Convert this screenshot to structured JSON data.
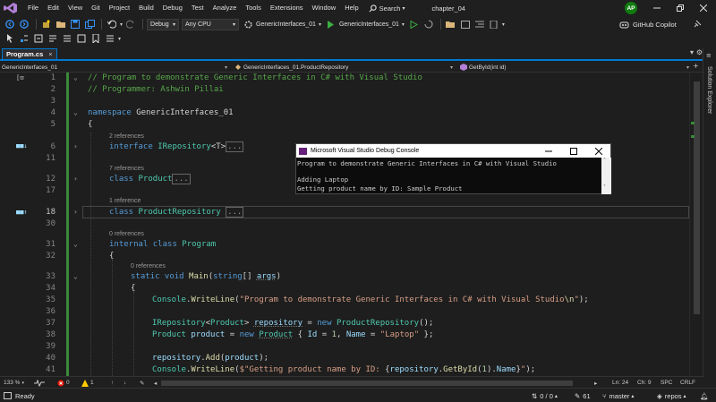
{
  "menubar": {
    "items": [
      {
        "label": "File"
      },
      {
        "label": "Edit"
      },
      {
        "label": "View"
      },
      {
        "label": "Git"
      },
      {
        "label": "Project"
      },
      {
        "label": "Build"
      },
      {
        "label": "Debug"
      },
      {
        "label": "Test"
      },
      {
        "label": "Analyze"
      },
      {
        "label": "Tools"
      },
      {
        "label": "Extensions"
      },
      {
        "label": "Window"
      },
      {
        "label": "Help"
      }
    ],
    "search_label": "Search",
    "solution_name": "chapter_04",
    "avatar_initials": "AP"
  },
  "toolbar": {
    "configuration": "Debug",
    "platform": "Any CPU",
    "startup_project": "GenericInterfaces_01",
    "run_target": "GenericInterfaces_01",
    "copilot_label": "GitHub Copilot"
  },
  "tab": {
    "title": "Program.cs",
    "close_glyph": "×"
  },
  "navbar": {
    "project": "GenericInterfaces_01",
    "type": "GenericInterfaces_01.ProductRepository",
    "member": "GetById(int id)"
  },
  "side_panel": {
    "label": "Solution Explorer"
  },
  "editor": {
    "line_numbers": [
      "1",
      "2",
      "3",
      "4",
      "5",
      "6",
      "11",
      "12",
      "17",
      "18",
      "30",
      "31",
      "32",
      "33",
      "34",
      "35",
      "36",
      "37",
      "38",
      "39",
      "40",
      "41"
    ],
    "codelens": {
      "refs_2": "2 references",
      "refs_7": "7 references",
      "refs_1": "1 reference",
      "refs_0a": "0 references",
      "refs_0b": "0 references"
    },
    "code": {
      "l1_comment": "// Program to demonstrate Generic Interfaces in C# with Visual Studio",
      "l2_comment": "// Programmer: Ashwin Pillai",
      "l4_kw": "namespace",
      "l4_name": "GenericInterfaces_01",
      "brace_open": "{",
      "l6_kw": "interface",
      "l6_name": "IRepository",
      "l6_generic": "<T>",
      "collapsed": "...",
      "l12_kw": "class",
      "l12_name": "Product",
      "l18_kw": "class",
      "l18_name": "ProductRepository",
      "l31_kw": "internal class",
      "l31_name": "Program",
      "l33_kw": "static void",
      "l33_name": "Main",
      "l33_paren_open": "(",
      "l33_type": "string",
      "l33_rest": "[] ",
      "l33_arg": "args",
      "l33_paren_close": ")",
      "l35_obj": "Console",
      "l35_dot": ".",
      "l35_method": "WriteLine",
      "l35_open": "(",
      "l35_string": "\"Program to demonstrate Generic Interfaces in C# with Visual Studio",
      "l35_escape": "\\n",
      "l35_string_end": "\"",
      "l35_close": ");",
      "l37_type": "IRepository",
      "l37_lt": "<",
      "l37_type2": "Product",
      "l37_gt": "> ",
      "l37_var": "repository",
      "l37_eq": " = ",
      "l37_new": "new",
      "l37_sp": " ",
      "l37_class": "ProductRepository",
      "l37_end": "();",
      "l38_type": "Product",
      "l38_sp": " ",
      "l38_var": "product",
      "l38_eq": " = ",
      "l38_new": "new",
      "l38_sp2": " ",
      "l38_class": "Product",
      "l38_open": " { ",
      "l38_id": "Id",
      "l38_eq2": " = ",
      "l38_num": "1",
      "l38_comma": ", ",
      "l38_namep": "Name",
      "l38_eq3": " = ",
      "l38_str": "\"Laptop\"",
      "l38_close": " };",
      "l40_var": "repository",
      "l40_dot": ".",
      "l40_method": "Add",
      "l40_open": "(",
      "l40_arg": "product",
      "l40_close": ");",
      "l41_obj": "Console",
      "l41_dot": ".",
      "l41_method": "WriteLine",
      "l41_open": "(",
      "l41_str1": "$\"Getting product name by ID: ",
      "l41_brace1": "{",
      "l41_var": "repository",
      "l41_dot2": ".",
      "l41_m2": "GetById",
      "l41_p1": "(",
      "l41_num": "1",
      "l41_p2": ").",
      "l41_prop": "Name",
      "l41_brace2": "}",
      "l41_str2": "\"",
      "l41_close": ");"
    }
  },
  "console": {
    "title": "Microsoft Visual Studio Debug Console",
    "lines": [
      "Program to demonstrate Generic Interfaces in C# with Visual Studio",
      "",
      "Adding Laptop",
      "Getting product name by ID: Sample Product"
    ]
  },
  "editor_footer": {
    "zoom": "133 %",
    "errors": "0",
    "warnings": "1",
    "line": "Ln: 24",
    "column": "Ch: 9",
    "whitespace": "SPC",
    "line_endings": "CRLF"
  },
  "statusbar": {
    "ready": "Ready",
    "git_changes": "0 / 0",
    "pencil_count": "61",
    "branch": "master",
    "repo": "repos"
  },
  "colors": {
    "accent": "#0078d4",
    "keyword": "#569cd6",
    "type": "#4ec9b0",
    "string": "#d69d85",
    "comment": "#57a64a",
    "method": "#dcdcaa",
    "error": "#e51400",
    "warning": "#ffcc00",
    "success": "#3a8a3a"
  }
}
